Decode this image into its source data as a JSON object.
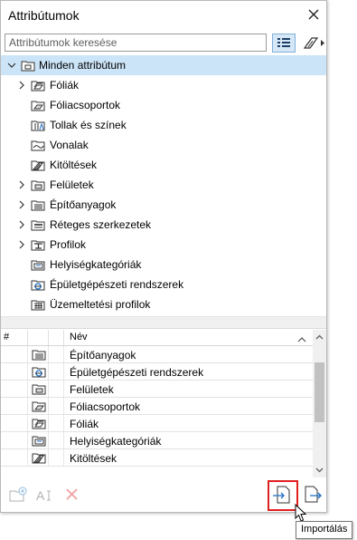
{
  "window": {
    "title": "Attribútumok"
  },
  "search": {
    "placeholder": "Attribútumok keresése",
    "value": ""
  },
  "tree": {
    "root": {
      "label": "Minden attribútum",
      "icon": "folder-all-icon",
      "expanded": true,
      "selected": true
    },
    "items": [
      {
        "label": "Fóliák",
        "icon": "layers-icon",
        "has_children": true
      },
      {
        "label": "Fóliacsoportok",
        "icon": "layer-combinations-icon",
        "has_children": false
      },
      {
        "label": "Tollak és színek",
        "icon": "pens-colors-icon",
        "has_children": false
      },
      {
        "label": "Vonalak",
        "icon": "line-types-icon",
        "has_children": false
      },
      {
        "label": "Kitöltések",
        "icon": "fills-icon",
        "has_children": false
      },
      {
        "label": "Felületek",
        "icon": "surfaces-icon",
        "has_children": true
      },
      {
        "label": "Építőanyagok",
        "icon": "building-materials-icon",
        "has_children": true
      },
      {
        "label": "Réteges szerkezetek",
        "icon": "composites-icon",
        "has_children": true
      },
      {
        "label": "Profilok",
        "icon": "profiles-icon",
        "has_children": true
      },
      {
        "label": "Helyiségkategóriák",
        "icon": "zone-categories-icon",
        "has_children": false
      },
      {
        "label": "Épületgépészeti rendszerek",
        "icon": "mep-systems-icon",
        "has_children": false
      },
      {
        "label": "Üzemeltetési profilok",
        "icon": "operation-profiles-icon",
        "has_children": false
      }
    ]
  },
  "list": {
    "columns": {
      "hash": "#",
      "name": "Név"
    },
    "rows": [
      {
        "name": "Építőanyagok",
        "icon": "building-materials-icon"
      },
      {
        "name": "Épületgépészeti rendszerek",
        "icon": "mep-systems-icon"
      },
      {
        "name": "Felületek",
        "icon": "surfaces-icon"
      },
      {
        "name": "Fóliacsoportok",
        "icon": "layer-combinations-icon"
      },
      {
        "name": "Fóliák",
        "icon": "layers-icon"
      },
      {
        "name": "Helyiségkategóriák",
        "icon": "zone-categories-icon"
      },
      {
        "name": "Kitöltések",
        "icon": "fills-icon"
      }
    ]
  },
  "toolbar": {
    "new_folder": {
      "icon": "new-folder-icon",
      "enabled": false
    },
    "rename": {
      "icon": "rename-icon",
      "enabled": false
    },
    "delete": {
      "icon": "delete-icon",
      "enabled": false
    },
    "import": {
      "icon": "import-icon",
      "tooltip": "Importálás",
      "highlighted": true
    },
    "export": {
      "icon": "export-icon"
    }
  },
  "colors": {
    "selection": "#cce4f7",
    "highlight_border": "#e02020",
    "icon_blue": "#1f6fc5",
    "icon_dark": "#3a3a3a"
  }
}
